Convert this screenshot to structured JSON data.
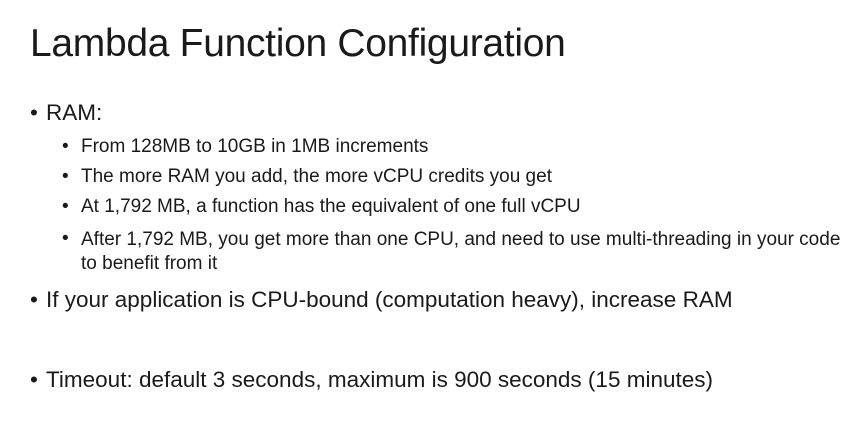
{
  "slide": {
    "title": "Lambda Function Configuration",
    "bullet_char": "•",
    "ram": {
      "label": "RAM:",
      "sub_items": [
        "From 128MB to 10GB in 1MB increments",
        "The more RAM you add, the more vCPU credits you get",
        "At 1,792 MB, a function has the equivalent of one full vCPU",
        "After 1,792 MB, you get more than one CPU, and need to use multi-threading in your code to benefit from it"
      ]
    },
    "cpu_bound": "If your application is CPU-bound (computation heavy), increase RAM",
    "timeout": {
      "label": "Timeout:",
      "text": " default 3 seconds, maximum is 900 seconds (15 minutes)"
    }
  }
}
